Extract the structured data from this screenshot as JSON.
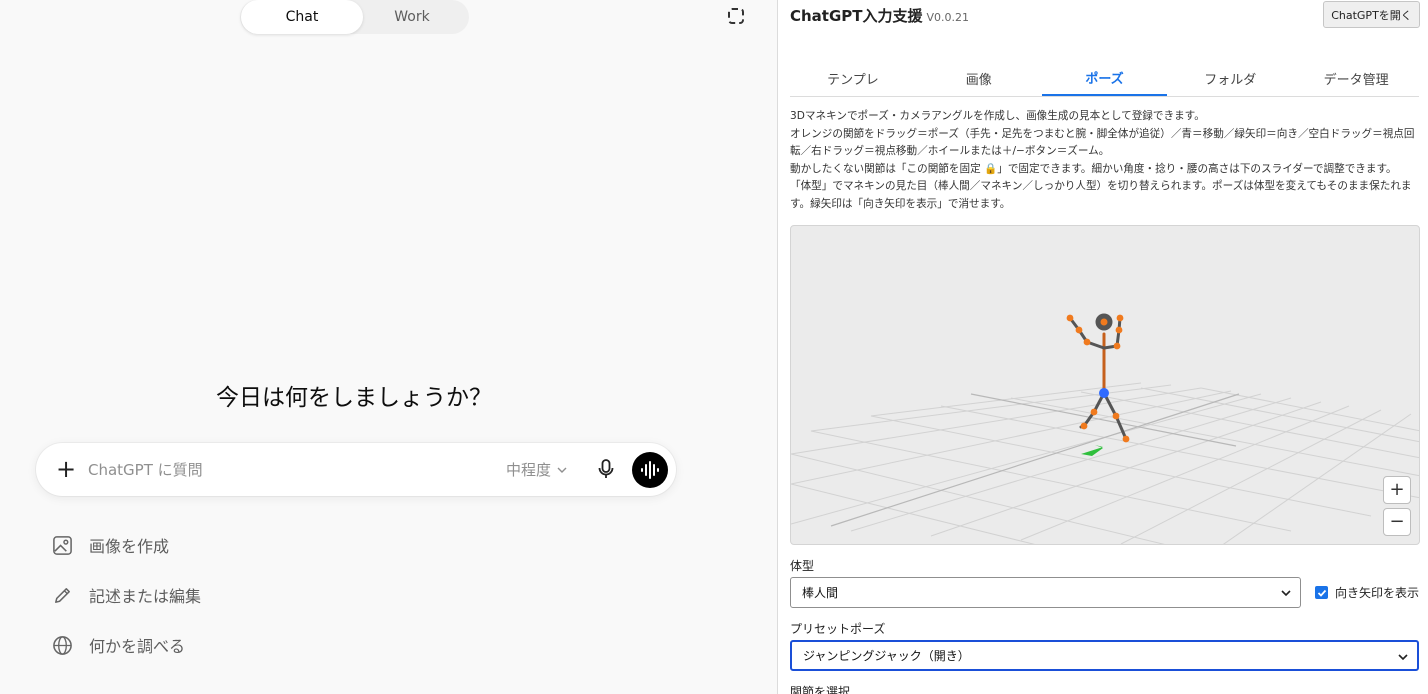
{
  "chat": {
    "mode_tabs": [
      {
        "label": "Chat",
        "active": true
      },
      {
        "label": "Work",
        "active": false
      }
    ],
    "greeting": "今日は何をしましょうか？",
    "composer": {
      "placeholder": "ChatGPT に質問",
      "effort_label": "中程度"
    },
    "suggestions": [
      {
        "label": "画像を作成",
        "icon": "image-icon"
      },
      {
        "label": "記述または編集",
        "icon": "pencil-icon"
      },
      {
        "label": "何かを調べる",
        "icon": "globe-icon"
      }
    ]
  },
  "extension": {
    "title": "ChatGPT入力支援",
    "version": "V0.0.21",
    "open_button": "ChatGPTを開く",
    "tabs": [
      {
        "label": "テンプレ",
        "active": false
      },
      {
        "label": "画像",
        "active": false
      },
      {
        "label": "ポーズ",
        "active": true
      },
      {
        "label": "フォルダ",
        "active": false
      },
      {
        "label": "データ管理",
        "active": false
      }
    ],
    "description": [
      "3Dマネキンでポーズ・カメラアングルを作成し、画像生成の見本として登録できます。",
      "オレンジの関節をドラッグ＝ポーズ（手先・足先をつまむと腕・脚全体が追従）／青＝移動／緑矢印＝向き／空白ドラッグ＝視点回転／右ドラッグ＝視点移動／ホイールまたは＋/−ボタン＝ズーム。",
      "動かしたくない関節は「この関節を固定 🔒」で固定できます。細かい角度・捻り・腰の高さは下のスライダーで調整できます。",
      "「体型」でマネキンの見た目（棒人間／マネキン／しっかり人型）を切り替えられます。ポーズは体型を変えてもそのまま保たれます。緑矢印は「向き矢印を表示」で消せます。"
    ],
    "zoom_in": "+",
    "zoom_out": "−",
    "body_type_label": "体型",
    "body_type_value": "棒人間",
    "show_arrow_label": "向き矢印を表示",
    "show_arrow_checked": true,
    "preset_label": "プリセットポーズ",
    "preset_value": "ジャンピングジャック（開き）",
    "joint_select_label": "関節を選択",
    "colors": {
      "accent": "#1a73e8",
      "joint": "#f07a1e",
      "root_joint": "#2f6bff",
      "arrow": "#2fbf3c",
      "bone": "#555555",
      "spine": "#c6601c"
    }
  }
}
